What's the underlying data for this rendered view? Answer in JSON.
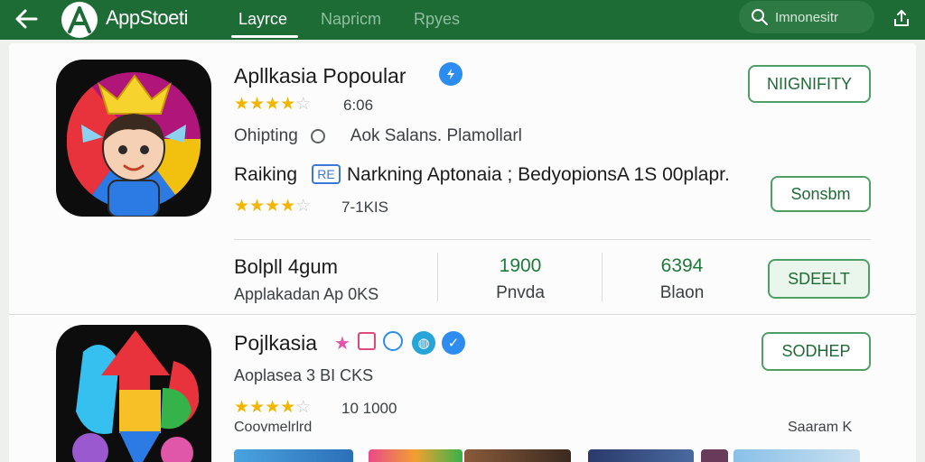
{
  "header": {
    "app_title": "AppStoeti",
    "tabs": [
      {
        "label": "Layrce",
        "active": true
      },
      {
        "label": "Napricm",
        "active": false
      },
      {
        "label": "Rpyes",
        "active": false
      }
    ],
    "search_text": "Imnonesitr",
    "colors": {
      "bar": "#1d6b35",
      "accent": "#1e7a3b"
    }
  },
  "app1": {
    "title": "Apllkasia Popoular",
    "rating_text": "6:06",
    "stars": 4,
    "meta_left": "Ohipting",
    "meta_right": "Aok Salans. Plamollarl",
    "ranking_label": "Raiking",
    "ranking_badge": "RE",
    "ranking_text": "Narkning Aptonaia ; BedyopionsA 1S 00plapr.",
    "rating2_text": "7-1KIS",
    "button_top": "NIIGNIFITY",
    "button_second": "Sonsbm"
  },
  "stats_row": {
    "title": "Bolpll 4gum",
    "subtitle": "Applakadan Ap 0KS",
    "stat1_value": "1900",
    "stat1_label": "Pnvda",
    "stat2_value": "6394",
    "stat2_label": "Blaon",
    "button": "SDEELT"
  },
  "app2": {
    "title": "Pojlkasia",
    "subtitle": "Aoplasea 3 BI CKS",
    "rating_text": "10 1000",
    "stars": 4,
    "footer_left": "Coovmelrlrd",
    "footer_right": "Saaram K",
    "button": "SODHEP"
  }
}
